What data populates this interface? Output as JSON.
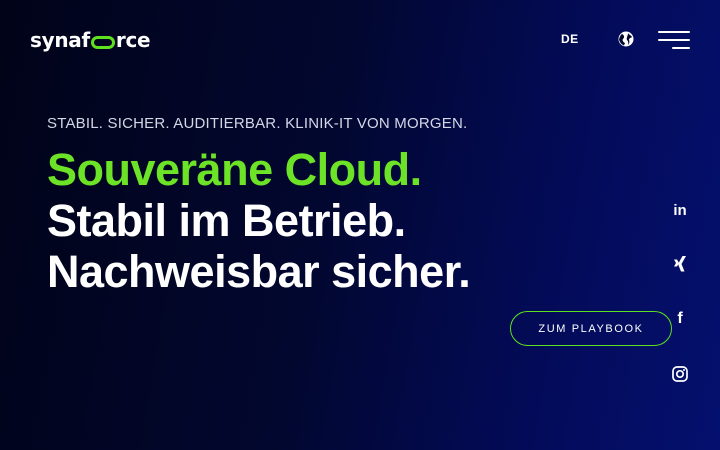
{
  "header": {
    "logo": {
      "prefix": "synaf",
      "suffix": "rce"
    },
    "language_label": "DE",
    "icons": {
      "language": "globe-icon",
      "menu": "hamburger-menu-icon"
    }
  },
  "hero": {
    "tagline": "STABIL. SICHER. AUDITIERBAR. KLINIK-IT VON MORGEN.",
    "headline": {
      "line1": "Souveräne Cloud.",
      "line2": "Stabil im Betrieb.",
      "line3": "Nachweisbar sicher."
    },
    "cta_label": "ZUM PLAYBOOK"
  },
  "social": {
    "linkedin_label": "in",
    "facebook_label": "f",
    "icons": [
      "linkedin-icon",
      "xing-icon",
      "facebook-icon",
      "instagram-icon"
    ]
  },
  "colors": {
    "accent_green": "#6de327",
    "background_dark": "#010318",
    "background_blue": "#04106e",
    "text": "#ffffff"
  }
}
